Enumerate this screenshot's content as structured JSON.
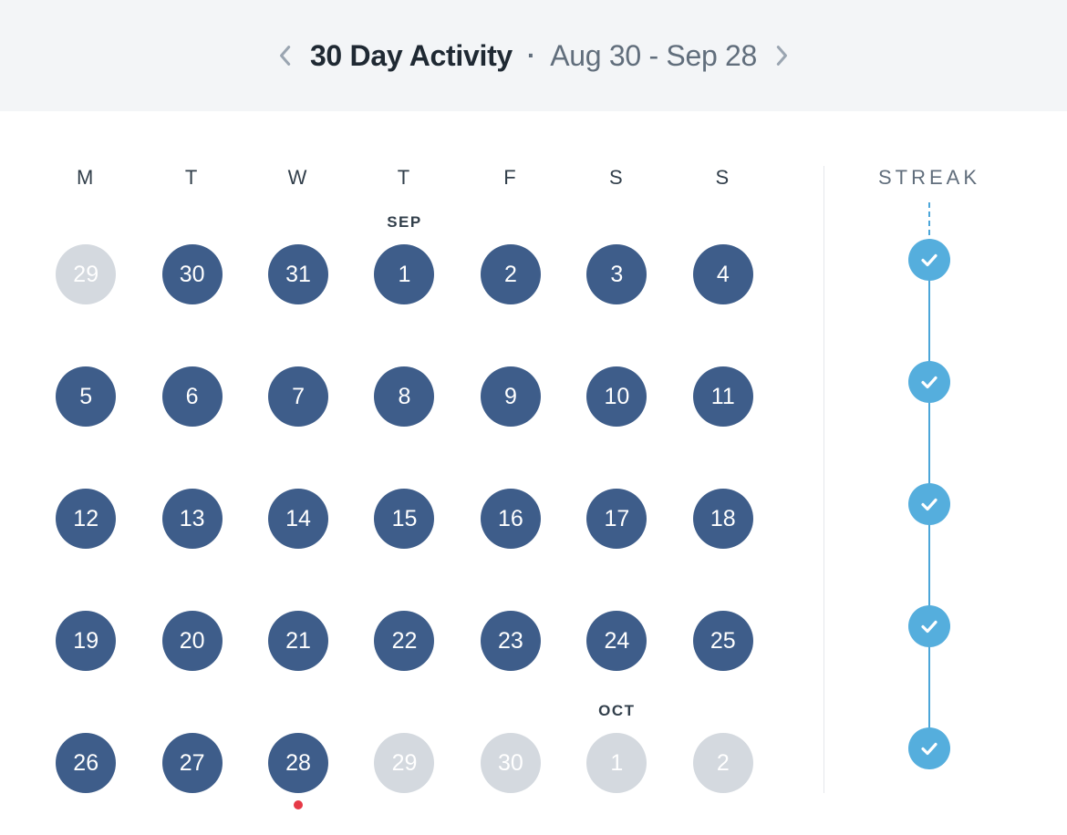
{
  "header": {
    "title": "30 Day Activity",
    "separator": "·",
    "range": "Aug 30 - Sep 28"
  },
  "calendar": {
    "day_of_week_labels": [
      "M",
      "T",
      "W",
      "T",
      "F",
      "S",
      "S"
    ],
    "weeks": [
      [
        {
          "day": "29",
          "state": "inactive",
          "month_tag": null,
          "today": false
        },
        {
          "day": "30",
          "state": "completed",
          "month_tag": null,
          "today": false
        },
        {
          "day": "31",
          "state": "completed",
          "month_tag": null,
          "today": false
        },
        {
          "day": "1",
          "state": "completed",
          "month_tag": "SEP",
          "today": false
        },
        {
          "day": "2",
          "state": "completed",
          "month_tag": null,
          "today": false
        },
        {
          "day": "3",
          "state": "completed",
          "month_tag": null,
          "today": false
        },
        {
          "day": "4",
          "state": "completed",
          "month_tag": null,
          "today": false
        }
      ],
      [
        {
          "day": "5",
          "state": "completed",
          "month_tag": null,
          "today": false
        },
        {
          "day": "6",
          "state": "completed",
          "month_tag": null,
          "today": false
        },
        {
          "day": "7",
          "state": "completed",
          "month_tag": null,
          "today": false
        },
        {
          "day": "8",
          "state": "completed",
          "month_tag": null,
          "today": false
        },
        {
          "day": "9",
          "state": "completed",
          "month_tag": null,
          "today": false
        },
        {
          "day": "10",
          "state": "completed",
          "month_tag": null,
          "today": false
        },
        {
          "day": "11",
          "state": "completed",
          "month_tag": null,
          "today": false
        }
      ],
      [
        {
          "day": "12",
          "state": "completed",
          "month_tag": null,
          "today": false
        },
        {
          "day": "13",
          "state": "completed",
          "month_tag": null,
          "today": false
        },
        {
          "day": "14",
          "state": "completed",
          "month_tag": null,
          "today": false
        },
        {
          "day": "15",
          "state": "completed",
          "month_tag": null,
          "today": false
        },
        {
          "day": "16",
          "state": "completed",
          "month_tag": null,
          "today": false
        },
        {
          "day": "17",
          "state": "completed",
          "month_tag": null,
          "today": false
        },
        {
          "day": "18",
          "state": "completed",
          "month_tag": null,
          "today": false
        }
      ],
      [
        {
          "day": "19",
          "state": "completed",
          "month_tag": null,
          "today": false
        },
        {
          "day": "20",
          "state": "completed",
          "month_tag": null,
          "today": false
        },
        {
          "day": "21",
          "state": "completed",
          "month_tag": null,
          "today": false
        },
        {
          "day": "22",
          "state": "completed",
          "month_tag": null,
          "today": false
        },
        {
          "day": "23",
          "state": "completed",
          "month_tag": null,
          "today": false
        },
        {
          "day": "24",
          "state": "completed",
          "month_tag": null,
          "today": false
        },
        {
          "day": "25",
          "state": "completed",
          "month_tag": null,
          "today": false
        }
      ],
      [
        {
          "day": "26",
          "state": "completed",
          "month_tag": null,
          "today": false
        },
        {
          "day": "27",
          "state": "completed",
          "month_tag": null,
          "today": false
        },
        {
          "day": "28",
          "state": "completed",
          "month_tag": null,
          "today": true
        },
        {
          "day": "29",
          "state": "inactive",
          "month_tag": null,
          "today": false
        },
        {
          "day": "30",
          "state": "inactive",
          "month_tag": null,
          "today": false
        },
        {
          "day": "1",
          "state": "inactive",
          "month_tag": "OCT",
          "today": false
        },
        {
          "day": "2",
          "state": "inactive",
          "month_tag": null,
          "today": false
        }
      ]
    ]
  },
  "streak": {
    "title": "STREAK",
    "checks": [
      true,
      true,
      true,
      true,
      true
    ]
  },
  "colors": {
    "completed": "#3e5d8a",
    "inactive": "#d4d9df",
    "streak_accent": "#55aedd",
    "today_dot": "#e63946"
  }
}
